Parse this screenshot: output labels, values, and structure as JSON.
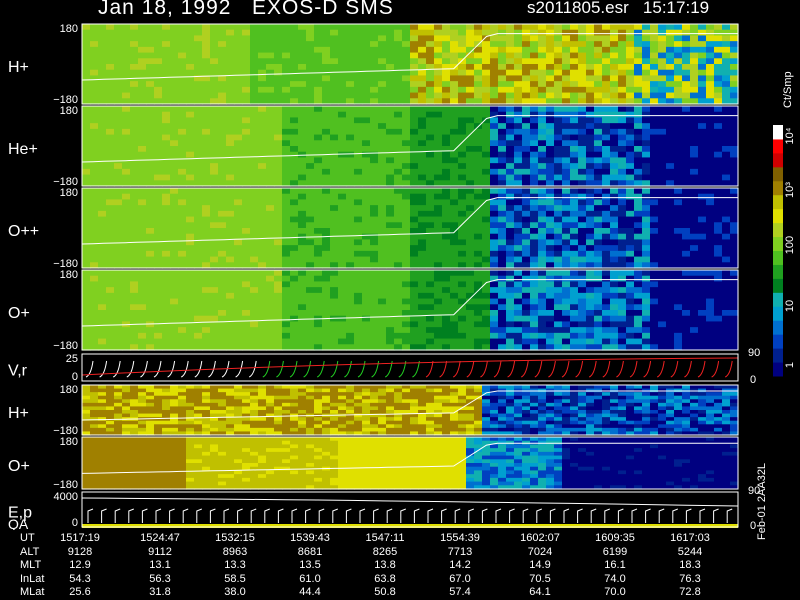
{
  "header": {
    "title": "Jan 18, 1992   EXOS-D SMS",
    "file_time": "s2011805.esr   15:17:19"
  },
  "colors": {
    "background": "#000000",
    "scale": [
      "#000080",
      "#00208f",
      "#0040c0",
      "#0070d0",
      "#00a0d0",
      "#10b0b0",
      "#008020",
      "#20a020",
      "#50c020",
      "#80d020",
      "#b0d020",
      "#e0e000",
      "#c0c000",
      "#a08000",
      "#806000",
      "#d00000",
      "#ff0000",
      "#ffffff"
    ]
  },
  "colorbar": {
    "unit": "Ct/Smp",
    "labels": [
      "10⁴",
      "10³",
      "100",
      "10",
      "1"
    ]
  },
  "panels": [
    {
      "label": "H+",
      "top": "180",
      "bottom": "−180"
    },
    {
      "label": "He+",
      "top": "180",
      "bottom": "−180"
    },
    {
      "label": "O++",
      "top": "180",
      "bottom": "−180"
    },
    {
      "label": "O+",
      "top": "180",
      "bottom": "−180"
    },
    {
      "label": "V,r",
      "top": "25",
      "bottom": "0",
      "right_top": "90",
      "right_bottom": "0"
    },
    {
      "label": "H+",
      "top": "180",
      "bottom": "−180"
    },
    {
      "label": "O+",
      "top": "180",
      "bottom": "−180"
    },
    {
      "label": "E,p",
      "label2": "QA",
      "top": "4000",
      "bottom": "0",
      "right_top": "90",
      "right_bottom": "0"
    }
  ],
  "chart_data": {
    "type": "heatmap",
    "title": "Jan 18, 1992   EXOS-D SMS",
    "x_rows": [
      {
        "name": "UT",
        "values": [
          "1517:19",
          "1524:47",
          "1532:15",
          "1539:43",
          "1547:11",
          "1554:39",
          "1602:07",
          "1609:35",
          "1617:03"
        ]
      },
      {
        "name": "ALT",
        "values": [
          "9128",
          "9112",
          "8963",
          "8681",
          "8265",
          "7713",
          "7024",
          "6199",
          "5244"
        ]
      },
      {
        "name": "MLT",
        "values": [
          "12.9",
          "13.1",
          "13.3",
          "13.5",
          "13.8",
          "14.2",
          "14.9",
          "16.1",
          "18.3"
        ]
      },
      {
        "name": "InLat",
        "values": [
          "54.3",
          "56.3",
          "58.5",
          "61.0",
          "63.8",
          "67.0",
          "70.5",
          "74.0",
          "76.3"
        ]
      },
      {
        "name": "MLat",
        "values": [
          "25.6",
          "31.8",
          "38.0",
          "44.4",
          "50.8",
          "57.4",
          "64.1",
          "70.0",
          "72.8"
        ]
      }
    ],
    "colorbar_scale": "log",
    "colorbar_range": [
      1,
      10000
    ]
  },
  "side_id": "Feb-01 2AA32L"
}
